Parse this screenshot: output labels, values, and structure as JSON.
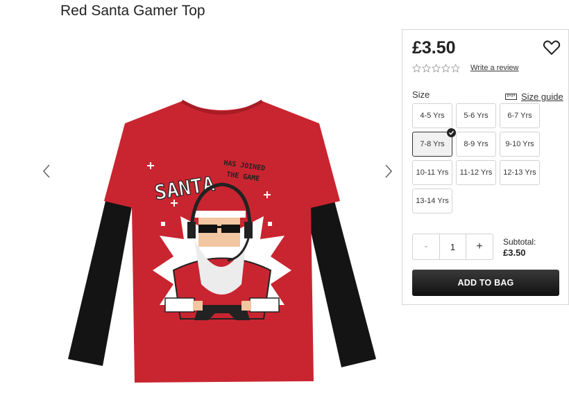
{
  "product": {
    "title": "Red Santa Gamer Top",
    "image_alt": "Red Santa Gamer Top"
  },
  "shirt_print": {
    "main": "SANTA",
    "side_line1": "HAS JOINED",
    "side_line2": "THE GAME"
  },
  "panel": {
    "price": "£3.50",
    "rating_stars": 0,
    "write_review": "Write a review",
    "size_label": "Size",
    "size_guide": "Size guide",
    "sizes": [
      "4-5 Yrs",
      "5-6 Yrs",
      "6-7 Yrs",
      "7-8 Yrs",
      "8-9 Yrs",
      "9-10 Yrs",
      "10-11 Yrs",
      "11-12 Yrs",
      "12-13 Yrs",
      "13-14 Yrs"
    ],
    "selected_size": "7-8 Yrs",
    "quantity": "1",
    "minus": "-",
    "plus": "+",
    "subtotal_label": "Subtotal:",
    "subtotal_value": "£3.50",
    "add_to_bag": "ADD TO BAG"
  },
  "colors": {
    "shirt_red": "#c92530",
    "sleeve_black": "#141414",
    "button_dark": "#222222"
  },
  "icons": {
    "heart": "heart-icon",
    "star": "star-outline-icon",
    "ruler": "ruler-icon",
    "check": "check-icon",
    "prev": "chevron-left-icon",
    "next": "chevron-right-icon"
  }
}
